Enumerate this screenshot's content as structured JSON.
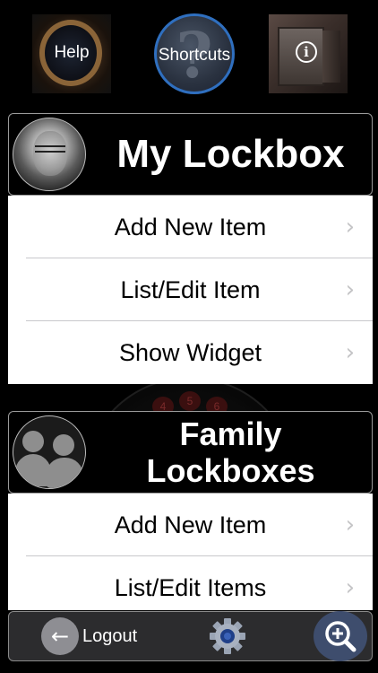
{
  "top_bar": {
    "help_label": "Help",
    "shortcuts_label": "Shortcuts",
    "shortcuts_glyph": "?",
    "info_glyph": "i"
  },
  "my_lockbox": {
    "title": "My Lockbox",
    "items": [
      {
        "label": "Add New Item",
        "chevron": "›"
      },
      {
        "label": "List/Edit Item",
        "chevron": "›"
      },
      {
        "label": "Show Widget",
        "chevron": "›"
      }
    ]
  },
  "family_lockboxes": {
    "title_line1": "Family",
    "title_line2": "Lockboxes",
    "items": [
      {
        "label": "Add New Item",
        "chevron": "›"
      },
      {
        "label": "List/Edit Items",
        "chevron": "›"
      }
    ]
  },
  "background_dial": {
    "numbers": [
      "4",
      "5",
      "6"
    ]
  },
  "toolbar": {
    "logout_label": "Logout",
    "logout_glyph": "←"
  },
  "colors": {
    "background": "#000000",
    "accent_blue": "#2f6fbf",
    "toolbar": "#2c2c2e",
    "search_button": "#3e4d6d",
    "chevron": "#c4c4c6"
  }
}
